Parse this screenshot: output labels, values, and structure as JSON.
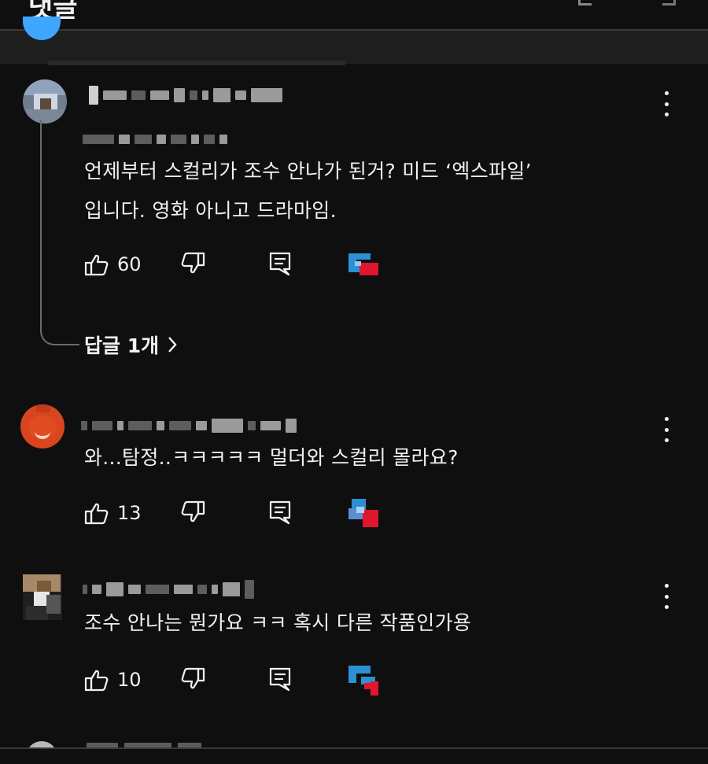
{
  "colors": {
    "background": "#0f0f0f",
    "text": "#f1f1f1",
    "accent_blue": "#3ea6ff",
    "thread_line": "#6b6b6b"
  },
  "header": {
    "title_fragment": "댓글"
  },
  "comments": [
    {
      "text": "언제부터 스컬리가 조수 안나가 된거? 미드 ‘엑스파일’\n입니다. 영화 아니고 드라마임.",
      "likes": "60",
      "icons": {
        "like": "thumbs-up-icon",
        "dislike": "thumbs-down-icon",
        "reply": "reply-icon",
        "menu": "more-vert-icon"
      }
    },
    {
      "text": "와...탐정..ㅋㅋㅋㅋㅋ 멀더와 스컬리 몰라요?",
      "likes": "13",
      "icons": {
        "like": "thumbs-up-icon",
        "dislike": "thumbs-down-icon",
        "reply": "reply-icon",
        "menu": "more-vert-icon"
      }
    },
    {
      "text": "조수 안나는 뭔가요 ㅋㅋ 혹시 다른 작품인가용",
      "likes": "10",
      "icons": {
        "like": "thumbs-up-icon",
        "dislike": "thumbs-down-icon",
        "reply": "reply-icon",
        "menu": "more-vert-icon"
      }
    }
  ],
  "replies_link": {
    "label": "답글 1개",
    "icon": "chevron-right-icon"
  }
}
